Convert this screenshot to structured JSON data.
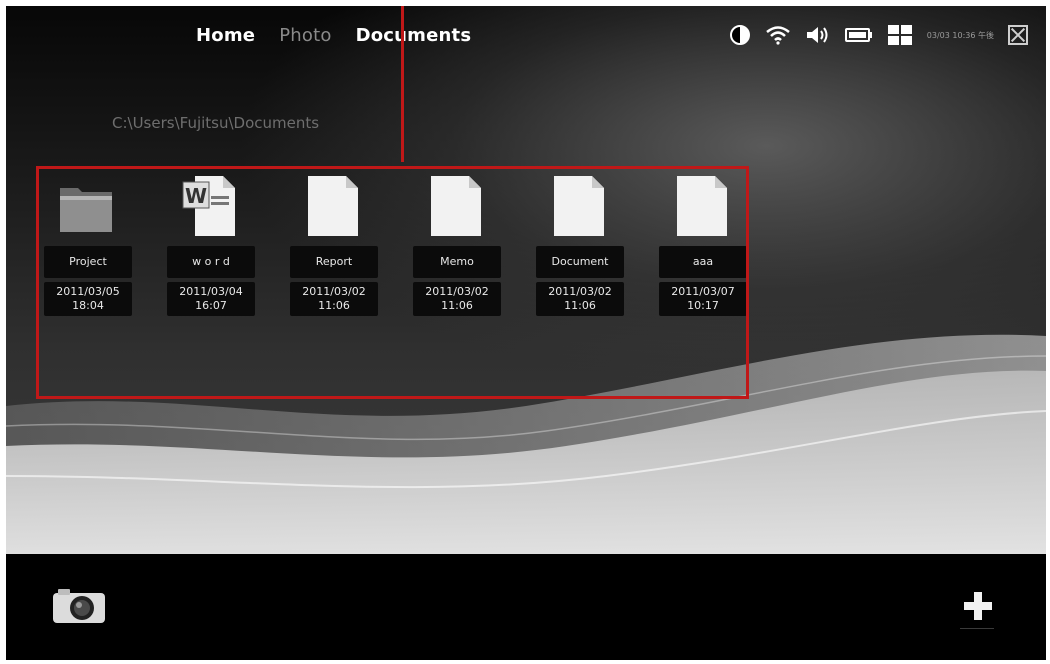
{
  "nav": {
    "items": [
      {
        "label": "Home",
        "active": true
      },
      {
        "label": "Photo",
        "active": false
      },
      {
        "label": "Documents",
        "active": true
      }
    ]
  },
  "status": {
    "icons": [
      "contrast-icon",
      "wifi-icon",
      "speaker-icon",
      "battery-icon",
      "grid-view-icon",
      "close-icon"
    ],
    "clock": "03/03 10:36 午後"
  },
  "path": "C:\\Users\\Fujitsu\\Documents",
  "files": [
    {
      "name": "Project",
      "type": "folder",
      "date": "2011/03/05",
      "time": "18:04"
    },
    {
      "name": "w o r d",
      "type": "word",
      "date": "2011/03/04",
      "time": "16:07"
    },
    {
      "name": "Report",
      "type": "document",
      "date": "2011/03/02",
      "time": "11:06"
    },
    {
      "name": "Memo",
      "type": "document",
      "date": "2011/03/02",
      "time": "11:06"
    },
    {
      "name": "Document",
      "type": "document",
      "date": "2011/03/02",
      "time": "11:06"
    },
    {
      "name": "aaa",
      "type": "document",
      "date": "2011/03/07",
      "time": "10:17"
    }
  ],
  "bottom": {
    "left_icon": "camera-icon",
    "right_icon": "plus-icon"
  },
  "colors": {
    "highlight": "#c01818",
    "background": "#000000"
  }
}
